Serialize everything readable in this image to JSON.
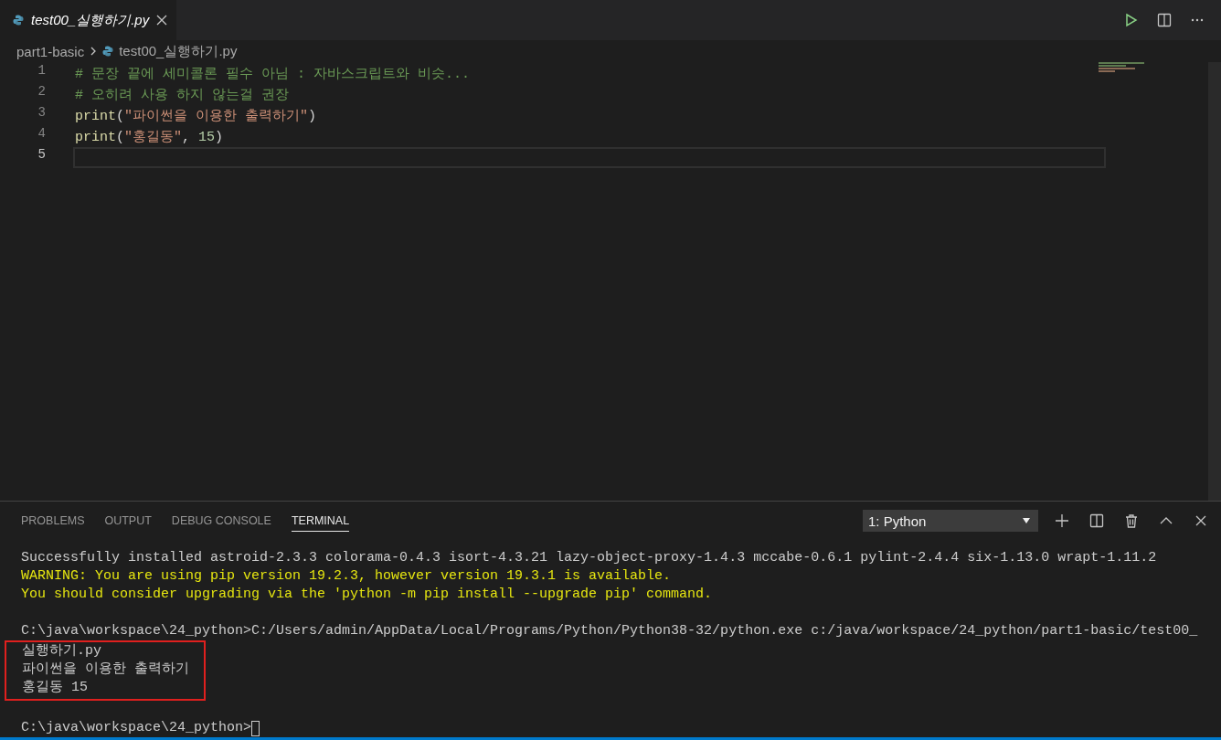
{
  "editor_tabs": [
    {
      "label": "test00_실행하기.py",
      "selected": true,
      "italic": true
    }
  ],
  "breadcrumb": [
    "part1-basic",
    "test00_실행하기.py"
  ],
  "code_lines": [
    {
      "number": "1",
      "selected": false,
      "tokens": [
        {
          "kind": "comment",
          "text": "# 문장 끝에 세미콜론 필수 아님 : 자바스크립트와 비슷..."
        }
      ]
    },
    {
      "number": "2",
      "selected": false,
      "tokens": [
        {
          "kind": "comment",
          "text": "# 오히려 사용 하지 않는걸 권장"
        }
      ]
    },
    {
      "number": "3",
      "selected": false,
      "tokens": [
        {
          "kind": "function",
          "text": "print"
        },
        {
          "kind": "plain",
          "text": "("
        },
        {
          "kind": "string",
          "text": "\"파이썬을 이용한 출력하기\""
        },
        {
          "kind": "plain",
          "text": ")"
        }
      ]
    },
    {
      "number": "4",
      "selected": false,
      "tokens": [
        {
          "kind": "function",
          "text": "print"
        },
        {
          "kind": "plain",
          "text": "("
        },
        {
          "kind": "string",
          "text": "\"홍길동\""
        },
        {
          "kind": "plain",
          "text": ", "
        },
        {
          "kind": "number",
          "text": "15"
        },
        {
          "kind": "plain",
          "text": ")"
        }
      ]
    },
    {
      "number": "5",
      "selected": true
    }
  ],
  "panel": {
    "tabs": [
      {
        "label": "PROBLEMS",
        "selected": false
      },
      {
        "label": "OUTPUT",
        "selected": false
      },
      {
        "label": "DEBUG CONSOLE",
        "selected": false
      },
      {
        "label": "TERMINAL",
        "selected": true
      }
    ],
    "terminal_select": {
      "value": "1: Python"
    },
    "terminal": [
      {
        "kind": "normal",
        "text": "Successfully installed astroid-2.3.3 colorama-0.4.3 isort-4.3.21 lazy-object-proxy-1.4.3 mccabe-0.6.1 pylint-2.4.4 six-1.13.0 wrapt-1.11.2"
      },
      {
        "kind": "warning",
        "text": "WARNING: You are using pip version 19.2.3, however version 19.3.1 is available."
      },
      {
        "kind": "warning",
        "text": "You should consider upgrading via the 'python -m pip install --upgrade pip' command."
      },
      {
        "kind": "blank"
      },
      {
        "kind": "normal",
        "text": "C:\\java\\workspace\\24_python>C:/Users/admin/AppData/Local/Programs/Python/Python38-32/python.exe c:/java/workspace/24_python/part1-basic/test00_"
      },
      {
        "kind": "highlight",
        "lines": [
          "실행하기.py",
          "파이썬을 이용한 출력하기",
          "홍길동 15"
        ]
      },
      {
        "kind": "blank"
      },
      {
        "kind": "prompt",
        "text": "C:\\java\\workspace\\24_python>"
      }
    ]
  }
}
